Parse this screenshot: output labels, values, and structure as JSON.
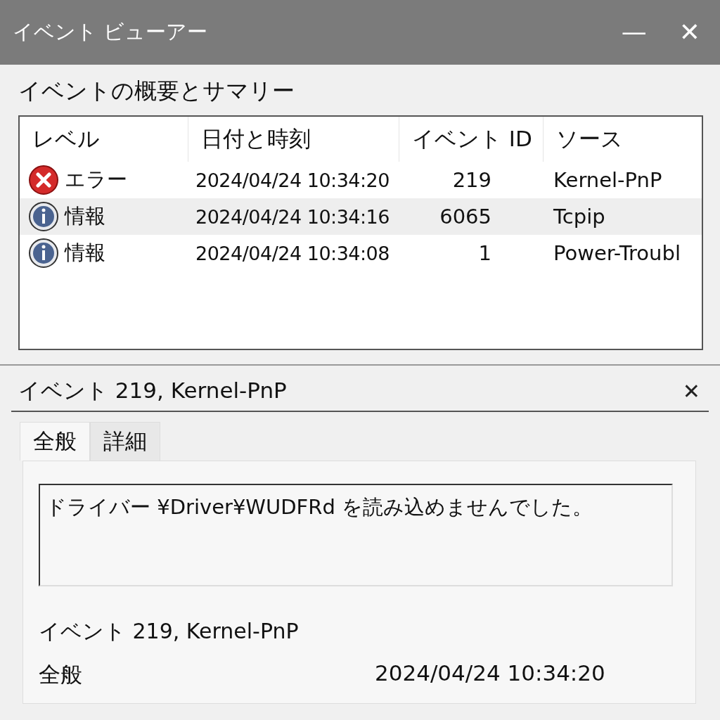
{
  "window": {
    "title": "イベント ビューアー",
    "minimize": "—",
    "close": "✕"
  },
  "summary": {
    "heading": "イベントの概要とサマリー",
    "columns": [
      "レベル",
      "日付と時刻",
      "イベント ID",
      "ソース"
    ],
    "rows": [
      {
        "kind": "error",
        "level": "エラー",
        "datetime": "2024/04/24 10:34:20",
        "event_id": "219",
        "source": "Kernel-PnP",
        "selected": false
      },
      {
        "kind": "info",
        "level": "情報",
        "datetime": "2024/04/24 10:34:16",
        "event_id": "6065",
        "source": "Tcpip",
        "selected": true
      },
      {
        "kind": "info",
        "level": "情報",
        "datetime": "2024/04/24 10:34:08",
        "event_id": "1",
        "source": "Power-Troubl",
        "selected": false
      }
    ]
  },
  "detail": {
    "title": "イベント 219, Kernel-PnP",
    "close": "✕",
    "tabs": [
      {
        "label": "全般",
        "selected": true
      },
      {
        "label": "詳細",
        "selected": false
      }
    ],
    "message": "ドライバー ¥Driver¥WUDFRd を読み込めませんでした。",
    "event_line": "イベント 219, Kernel-PnP",
    "category": "全般",
    "datetime": "2024/04/24 10:34:20"
  }
}
